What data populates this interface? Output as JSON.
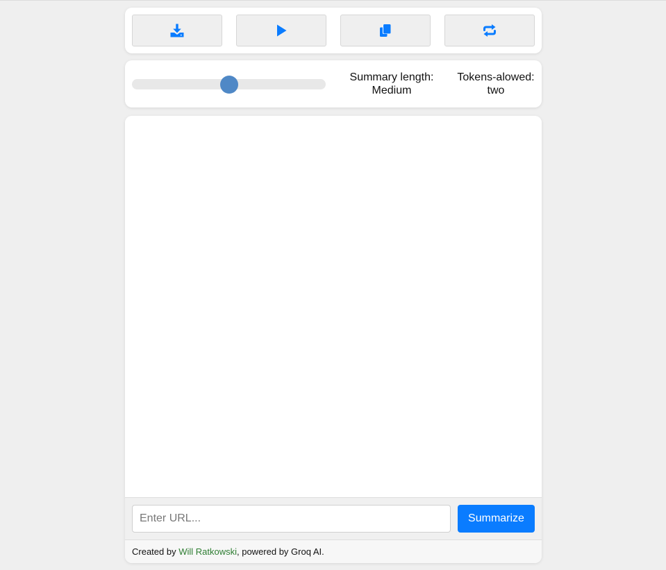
{
  "toolbar": {
    "buttons": [
      {
        "icon": "download-icon"
      },
      {
        "icon": "play-icon"
      },
      {
        "icon": "copy-icon"
      },
      {
        "icon": "repeat-icon"
      }
    ],
    "icon_color": "#0a7cff"
  },
  "controls": {
    "slider_level": 0.5,
    "summary_label": "Summary length:",
    "summary_value": "Medium",
    "tokens_label": "Tokens-alowed:",
    "tokens_value": "two"
  },
  "input": {
    "placeholder": "Enter URL...",
    "value": ""
  },
  "summarize_label": "Summarize",
  "footer": {
    "prefix": "Created by ",
    "author": "Will Ratkowski",
    "suffix": ", powered by Groq AI."
  },
  "colors": {
    "accent": "#0a7cff",
    "slider_thumb": "#4f88c6",
    "link": "#2e7d32"
  }
}
